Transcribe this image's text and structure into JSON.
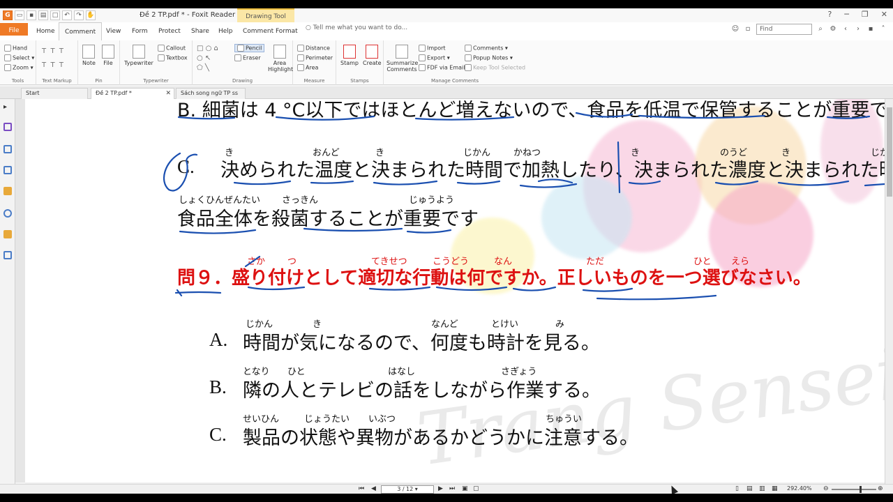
{
  "titlebar": {
    "app_logo": "G",
    "title": "Đề 2 TP.pdf * - Foxit Reader",
    "context_tab": "Drawing Tool",
    "window_controls": [
      "?",
      "─",
      "❐",
      "✕"
    ]
  },
  "menu": {
    "file": "File",
    "tabs": [
      "Home",
      "Comment",
      "View",
      "Form",
      "Protect",
      "Share",
      "Help",
      "Comment Format"
    ],
    "active": "Comment",
    "tell_me": "Tell me what you want to do...",
    "find_placeholder": "Find"
  },
  "ribbon": {
    "tools": {
      "label": "Tools",
      "items": [
        "Hand",
        "Select",
        "Zoom"
      ]
    },
    "text_markup": {
      "label": "Text Markup"
    },
    "pin": {
      "label": "Pin",
      "items": [
        "Note",
        "File"
      ]
    },
    "typewriter": {
      "label": "Typewriter",
      "items": [
        "Typewriter",
        "Callout",
        "Textbox"
      ]
    },
    "drawing": {
      "label": "Drawing",
      "items": [
        "Pencil",
        "Eraser"
      ]
    },
    "area": {
      "label": "Area Highlight"
    },
    "measure": {
      "label": "Measure",
      "items": [
        "Distance",
        "Perimeter",
        "Area"
      ]
    },
    "stamps": {
      "label": "Stamps",
      "items": [
        "Stamp",
        "Create"
      ]
    },
    "manage": {
      "label": "Manage Comments",
      "items": [
        "Summarize Comments",
        "Import",
        "Export",
        "FDF via Email",
        "Comments",
        "Popup Notes",
        "Keep Tool Selected"
      ]
    }
  },
  "doc_tabs": [
    {
      "label": "Start",
      "active": false
    },
    {
      "label": "Đề 2 TP.pdf *",
      "active": true
    },
    {
      "label": "Sách song ngữ TP ss ...",
      "active": false
    }
  ],
  "document": {
    "line_b": "B. 細菌は 4 °C以下ではほとんど増えないので、食品を低温で保管することが重要で",
    "line_c1_label": "C.",
    "line_c1_text": "決められた温度と決まられた時間で加熱したり、決まられた濃度と決まられた時",
    "line_c1_ruby": [
      "き",
      "おんど",
      "き",
      "じかん",
      "かねつ",
      "き",
      "のうど",
      "き",
      "じか"
    ],
    "line_c2_text": "食品全体を殺菌することが重要です",
    "line_c2_ruby": [
      "しょくひんぜんたい",
      "さっきん",
      "じゅうよう"
    ],
    "question": "問９．盛り付けとして適切な行動は何ですか。正しいものを一つ選びなさい。",
    "question_ruby": [
      "さか",
      "つ",
      "てきせつ",
      "こうどう",
      "なん",
      "ただ",
      "ひと",
      "えら"
    ],
    "options": [
      {
        "label": "A.",
        "text": "時間が気になるので、何度も時計を見る。",
        "ruby": [
          "じかん",
          "き",
          "なんど",
          "とけい",
          "み"
        ]
      },
      {
        "label": "B.",
        "text": "隣の人とテレビの話をしながら作業する。",
        "ruby": [
          "となり",
          "ひと",
          "はなし",
          "さぎょう"
        ]
      },
      {
        "label": "C.",
        "text": "製品の状態や異物があるかどうかに注意する。",
        "ruby": [
          "せいひん",
          "じょうたい",
          "いぶつ",
          "ちゅうい"
        ]
      }
    ],
    "watermark": "Trang Sensei"
  },
  "status": {
    "page_indicator": "3 / 12",
    "zoom": "292.40%",
    "zoom_fraction": 0.62
  },
  "colors": {
    "accent": "#ef7a26",
    "annotation_blue": "#1a4fb0",
    "question_red": "#d11111"
  }
}
